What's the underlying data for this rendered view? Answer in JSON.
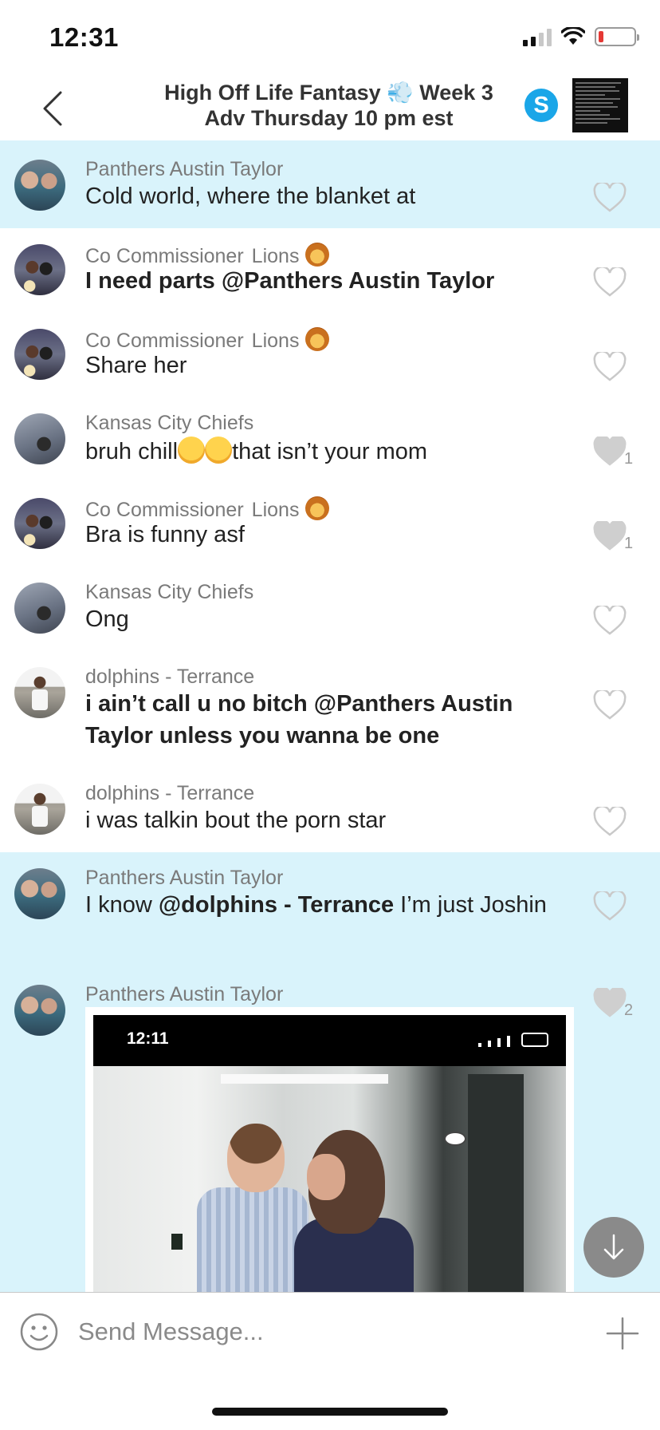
{
  "status_bar": {
    "time": "12:31",
    "battery_level": 0.1
  },
  "header": {
    "title": "High Off Life Fantasy 💨 Week 3 Adv Thursday 10 pm est",
    "skype_letter": "S"
  },
  "messages": [
    {
      "sender": "Panthers Austin Taylor",
      "team": "",
      "text": "Cold world, where the blanket at",
      "likes": ""
    },
    {
      "sender": "Co Commissioner",
      "team": "Lions",
      "text": "I need parts @Panthers Austin Taylor",
      "likes": ""
    },
    {
      "sender": "Co Commissioner",
      "team": "Lions",
      "text": "Share her",
      "likes": ""
    },
    {
      "sender": "Kansas City Chiefs",
      "team": "",
      "text_before": "bruh chill",
      "text_after": "that isn’t your mom",
      "likes": "1"
    },
    {
      "sender": "Co Commissioner",
      "team": "Lions",
      "text": "Bra is funny asf",
      "likes": "1"
    },
    {
      "sender": "Kansas City Chiefs",
      "team": "",
      "text": "Ong",
      "likes": ""
    },
    {
      "sender": "dolphins - Terrance",
      "team": "",
      "text": "i ain’t call u no bitch @Panthers Austin Taylor unless you wanna be one",
      "likes": ""
    },
    {
      "sender": "dolphins - Terrance",
      "team": "",
      "text": "i was talkin bout the porn star",
      "likes": ""
    },
    {
      "sender": "Panthers Austin Taylor",
      "team": "",
      "text_before": "I know ",
      "mention": "@dolphins - Terrance",
      "text_after": " I’m just Joshin",
      "likes": ""
    },
    {
      "sender": "Panthers Austin Taylor",
      "team": "",
      "image_time": "12:11",
      "likes": "2"
    }
  ],
  "composer": {
    "placeholder": "Send Message..."
  },
  "colors": {
    "highlight": "#d9f3fb",
    "skype": "#1aa6e8",
    "battery_low": "#e53935"
  },
  "icons": [
    "back-chevron-icon",
    "skype-icon",
    "heart-icon",
    "smiley-icon",
    "plus-icon",
    "arrow-down-icon"
  ]
}
